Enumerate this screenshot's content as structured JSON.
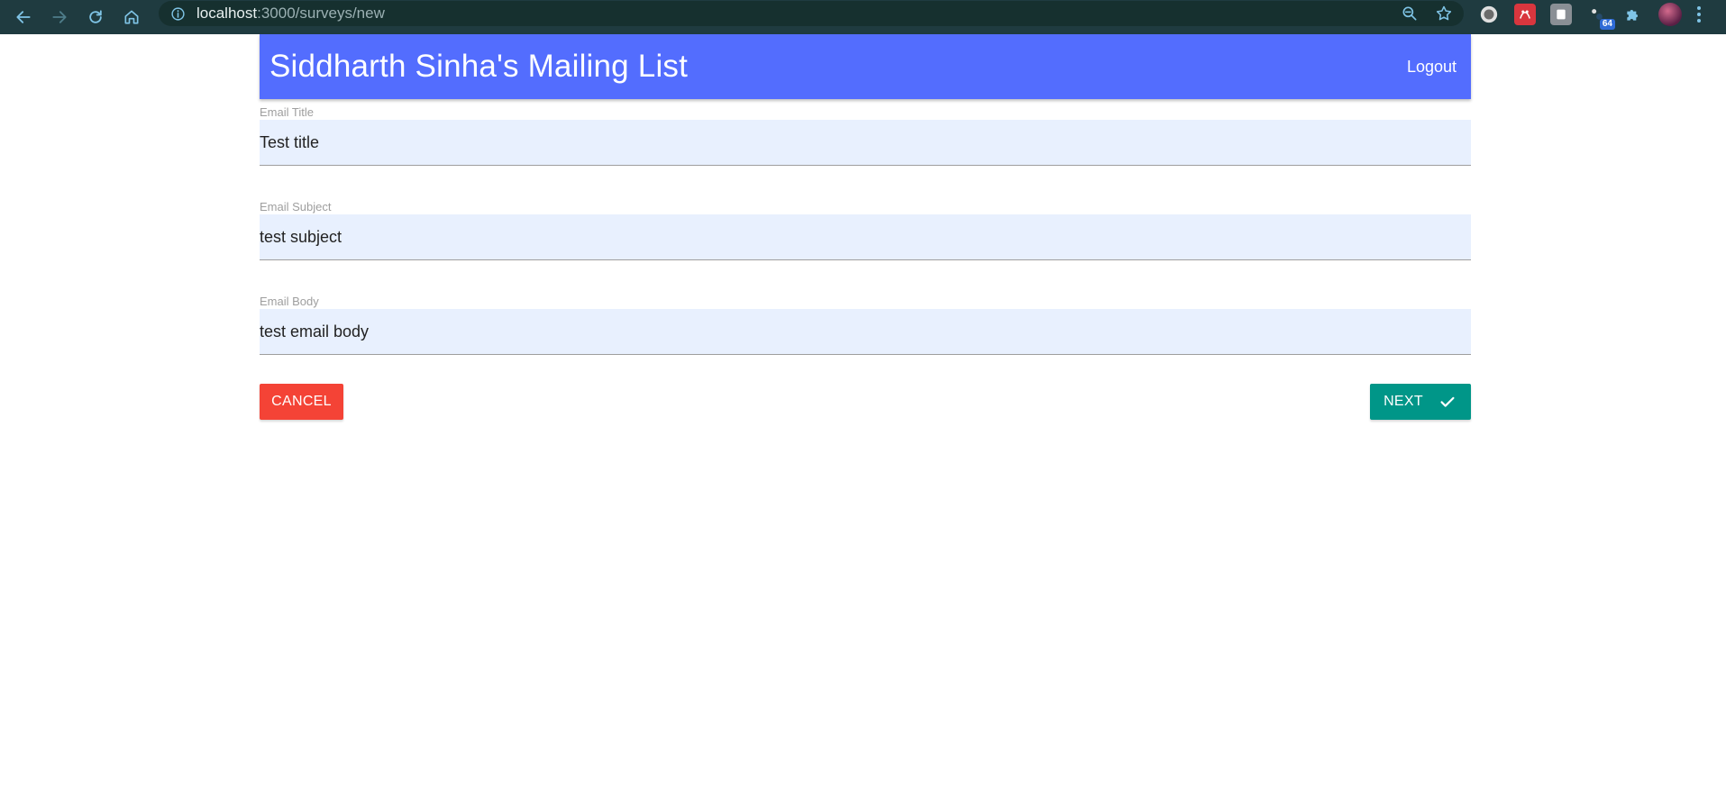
{
  "browser": {
    "url_host": "localhost",
    "url_path": ":3000/surveys/new",
    "extension_badge": "64",
    "icons": [
      "back-arrow-icon",
      "forward-arrow-icon",
      "reload-icon",
      "home-icon",
      "info-icon",
      "zoom-out-icon",
      "star-icon",
      "puzzle-icon",
      "kebab-menu-icon"
    ]
  },
  "header": {
    "brand": "Siddharth Sinha's Mailing List",
    "logout_label": "Logout",
    "color": "#536dfe"
  },
  "form": {
    "fields": [
      {
        "label": "Email Title",
        "value": "Test title"
      },
      {
        "label": "Email Subject",
        "value": "test subject"
      },
      {
        "label": "Email Body",
        "value": "test email body"
      }
    ],
    "cancel_label": "CANCEL",
    "next_label": "NEXT",
    "cancel_color": "#f44336",
    "next_color": "#009688"
  }
}
